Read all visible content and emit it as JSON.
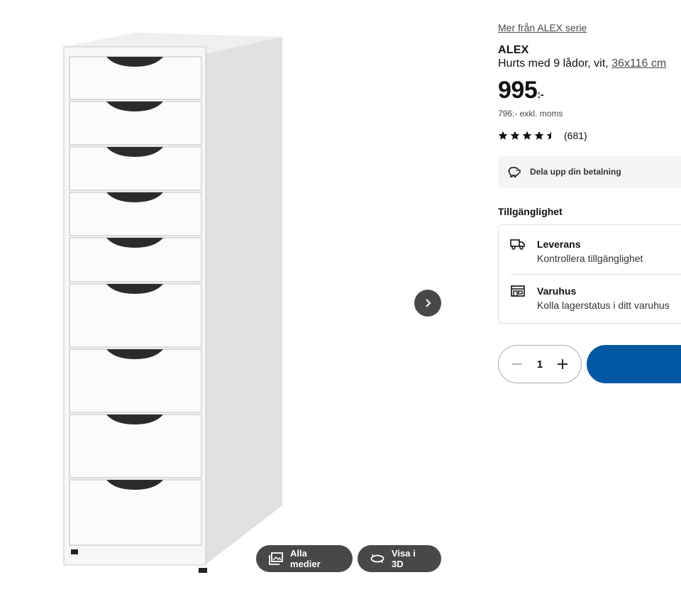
{
  "gallery": {
    "media_label": "Alla medier",
    "view3d_label": "Visa i 3D",
    "icons": {
      "next": "chevron-right-icon",
      "media": "image-gallery-icon",
      "view3d": "rotate-3d-icon"
    }
  },
  "product": {
    "series_link": "Mer från ALEX serie",
    "name": "ALEX",
    "description": "Hurts med 9 lådor, vit,",
    "size": "36x116 cm",
    "price": "995",
    "price_suffix": ":-",
    "ex_vat": "796:- exkl. moms",
    "rating": {
      "stars": 4.5,
      "max": 5,
      "count": "(681)"
    }
  },
  "payment": {
    "label": "Dela upp din betalning",
    "icon": "piggy-bank-icon"
  },
  "availability": {
    "title": "Tillgänglighet",
    "delivery": {
      "title": "Leverans",
      "subtitle": "Kontrollera tillgänglighet",
      "icon": "truck-icon"
    },
    "store": {
      "title": "Varuhus",
      "subtitle": "Kolla lagerstatus i ditt varuhus",
      "icon": "store-icon"
    }
  },
  "quantity": {
    "value": "1"
  },
  "colors": {
    "primary": "#0058a3",
    "dark_button": "#484848",
    "pay_bg": "#f5f5f5"
  }
}
